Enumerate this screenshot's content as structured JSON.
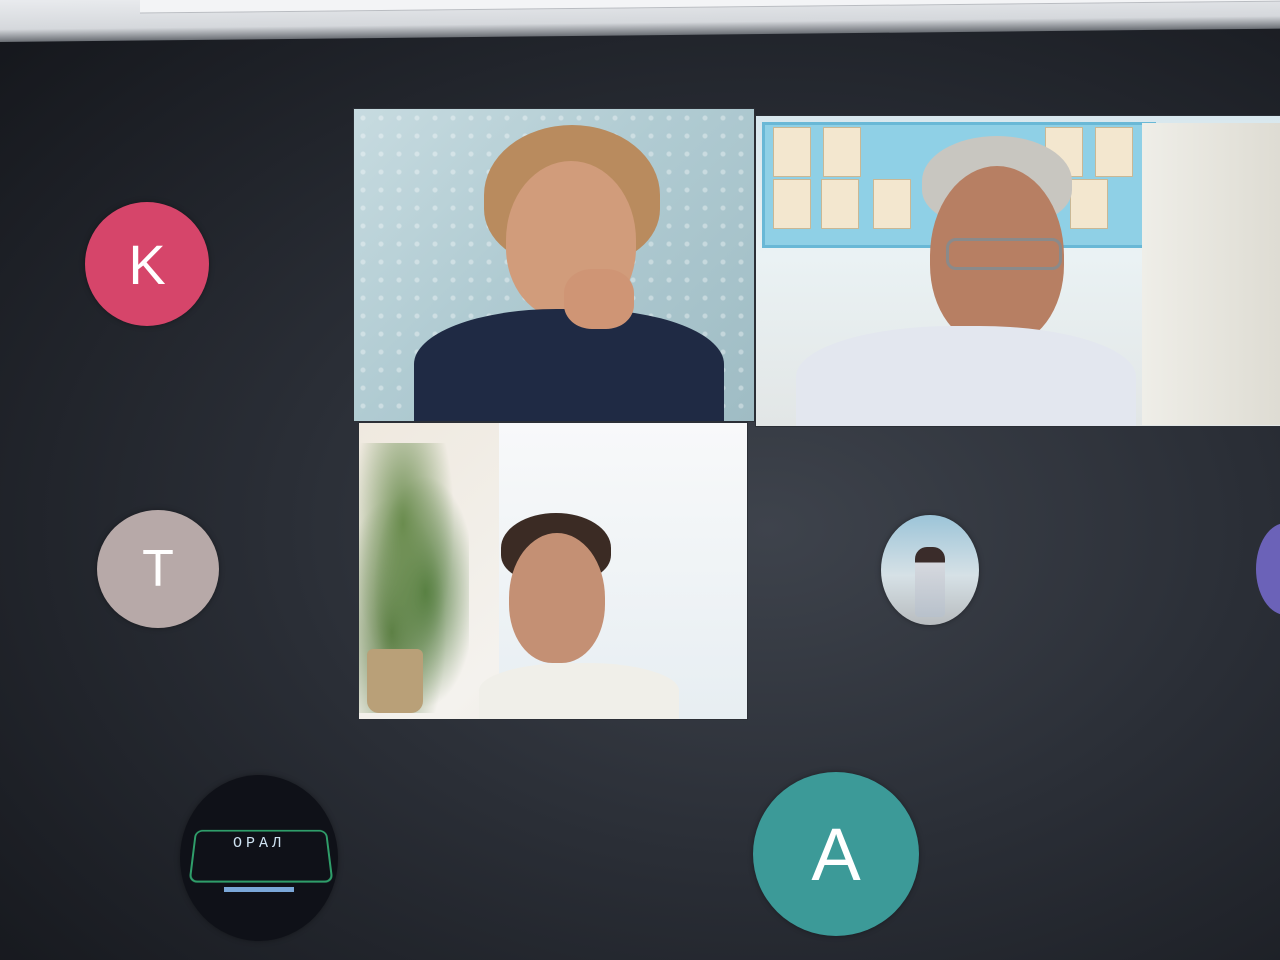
{
  "participants": [
    {
      "initial": "K",
      "color": "#d6456a",
      "type": "initial-avatar"
    },
    {
      "initial": "T",
      "color": "#b7a9a8",
      "type": "initial-avatar"
    },
    {
      "initial": "A",
      "color": "#3c9a98",
      "type": "initial-avatar"
    }
  ],
  "video_tiles": [
    {
      "label": "woman-video"
    },
    {
      "label": "man-video"
    },
    {
      "label": "young-man-video"
    }
  ],
  "logo_avatar": {
    "text": "ОРАЛ"
  },
  "photo_avatar": {
    "label": "photo-avatar"
  }
}
